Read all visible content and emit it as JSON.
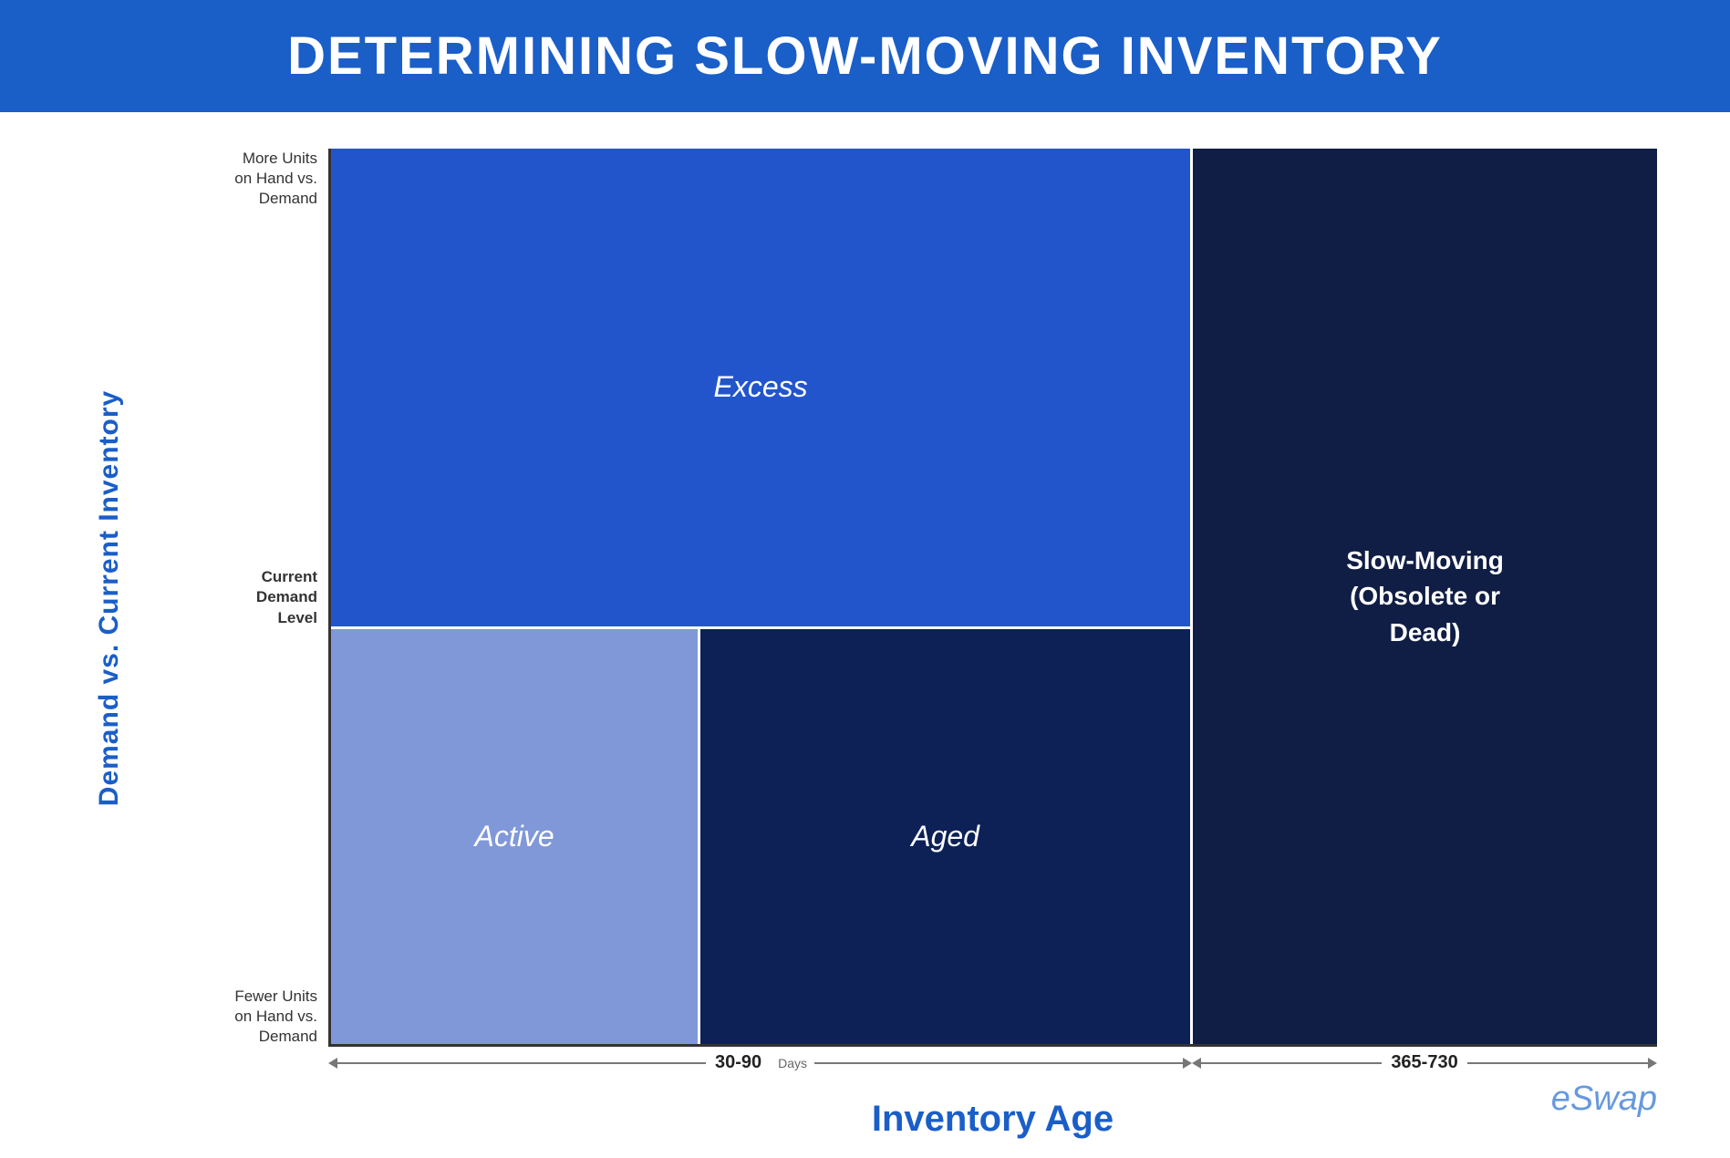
{
  "header": {
    "title": "DETERMINING SLOW-MOVING INVENTORY",
    "bg_color": "#1a5ec8"
  },
  "chart": {
    "y_axis_label": "Demand vs. Current Inventory",
    "y_ticks": {
      "top": "More Units\non Hand vs.\nDemand",
      "middle": "Current\nDemand\nLevel",
      "bottom": "Fewer Units\non Hand vs.\nDemand"
    },
    "cells": {
      "excess": "Excess",
      "active": "Active",
      "aged": "Aged",
      "slow_moving": "Slow-Moving\n(Obsolete or\nDead)"
    },
    "x_axis": {
      "label": "Inventory Age",
      "segment1_label": "30-90",
      "segment1_days": "Days",
      "segment2_label": "365-730"
    }
  },
  "logo": {
    "text": "eSwap"
  },
  "colors": {
    "header_blue": "#1a5ec8",
    "excess_blue": "#2255cc",
    "active_light": "#8098d8",
    "aged_dark": "#0d2157",
    "slow_darkest": "#101e45",
    "axis_blue": "#1a5ec8"
  }
}
